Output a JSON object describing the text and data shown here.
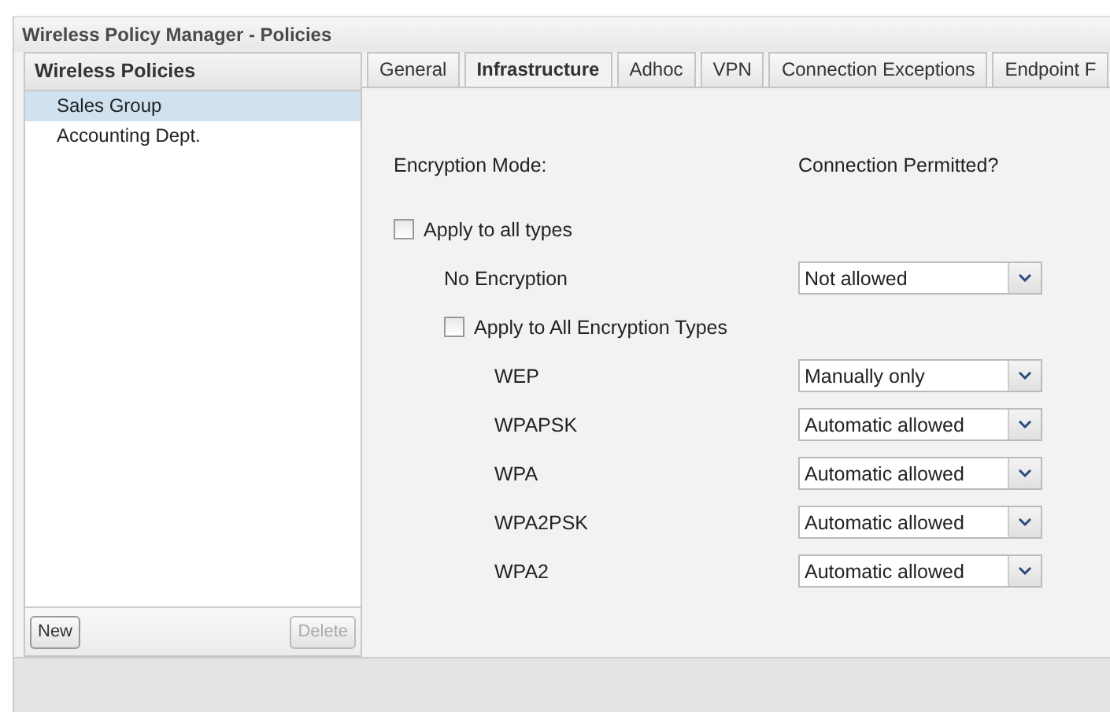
{
  "window": {
    "title": "Wireless Policy Manager - Policies"
  },
  "sidebar": {
    "title": "Wireless Policies",
    "items": [
      {
        "label": "Sales Group",
        "selected": true
      },
      {
        "label": "Accounting Dept.",
        "selected": false
      }
    ],
    "buttons": [
      {
        "label": "New",
        "disabled": false
      },
      {
        "label": "Delete",
        "disabled": true
      }
    ]
  },
  "tabs": [
    {
      "label": "General",
      "selected": false
    },
    {
      "label": "Infrastructure",
      "selected": true
    },
    {
      "label": "Adhoc",
      "selected": false
    },
    {
      "label": "VPN",
      "selected": false
    },
    {
      "label": "Connection Exceptions",
      "selected": false
    },
    {
      "label": "Endpoint F",
      "selected": false
    }
  ],
  "form": {
    "column_headers": [
      "Encryption Mode:",
      "Connection Permitted?"
    ],
    "items": [
      {
        "kind": "checkbox",
        "label": "Apply to all types",
        "checked": false,
        "children": [
          {
            "kind": "select",
            "label": "No Encryption",
            "value": "Not allowed"
          },
          {
            "kind": "checkbox",
            "label": "Apply to All Encryption Types",
            "checked": false,
            "children": [
              {
                "kind": "select",
                "label": "WEP",
                "value": "Manually only"
              },
              {
                "kind": "select",
                "label": "WPAPSK",
                "value": "Automatic allowed"
              },
              {
                "kind": "select",
                "label": "WPA",
                "value": "Automatic allowed"
              },
              {
                "kind": "select",
                "label": "WPA2PSK",
                "value": "Automatic allowed"
              },
              {
                "kind": "select",
                "label": "WPA2",
                "value": "Automatic allowed"
              }
            ]
          }
        ]
      }
    ]
  }
}
